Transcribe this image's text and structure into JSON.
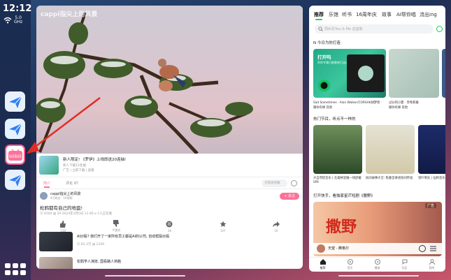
{
  "status": {
    "time": "12:12",
    "wifi_band": "5.0",
    "wifi_unit": "GHz"
  },
  "dock": {
    "apps": [
      {
        "name": "Feishu"
      },
      {
        "name": "Feishu (2)"
      },
      {
        "name": "bilibili",
        "badge": "bilibili"
      },
      {
        "name": "Feishu Docs"
      }
    ]
  },
  "bili": {
    "watermark": "cappi指尖上的风景",
    "watermark_logo": "bilibili",
    "notice": {
      "title": "新人限定! 《罗伊》上线即送20连抽!",
      "sub": "新人下载12连抽",
      "sub2": "广告 | 立即下载 | 查看"
    },
    "tabs": {
      "intro": "简介",
      "comments": "评论 97"
    },
    "danmu_placeholder": "点我发弹幕",
    "uploader": {
      "name": "cappi指尖上的风景",
      "fans": "4万粉丝 · 16视频"
    },
    "follow_label": "+ 关注",
    "video_title": "松鸦都有自己的地盘!",
    "video_meta": "⓵ 4504  ▤ 20  2024年1月5日 11:46  ⌀ 1人正在看",
    "actions": [
      {
        "label": "138"
      },
      {
        "label": "不喜欢"
      },
      {
        "label": "36"
      },
      {
        "label": "107"
      },
      {
        "label": "16"
      }
    ],
    "recs": [
      {
        "title": "AI炒股? 我们开了一家所有员工都是AI的公司, 自动帮股炒股",
        "meta": "⓵ 81.2万  ▤ 1249"
      },
      {
        "title": "松鸦学人演技, 国看路人熟胞",
        "meta": ""
      }
    ]
  },
  "music": {
    "tabs": [
      "推荐",
      "乐馆",
      "听书",
      "16周年庆",
      "故事",
      "AI帮你唱",
      "流出ing"
    ],
    "search_placeholder": "周AI写You & Me 这首歌",
    "section1": "N 今日为你打造",
    "card1": {
      "title": "打开吗",
      "sub": "你的专属日推歌单已送达\n根据每日推荐生成"
    },
    "card1_caption": "Sad Sometimes · Alan Walker/CORSAK胡梦周 ·",
    "card1_caption2": "跟你有缘 其他",
    "card2_caption": "过分的小夏 · 李希莉雅",
    "card2_caption2": "跟你有缘 其他",
    "section2": "热门节目，听点不一样的",
    "hot": [
      {
        "caption": "大自然轻音乐 | 在森林里做一场舒缓SPA"
      },
      {
        "caption": "民间故事大全: 陈嘉音讲述民间传说"
      },
      {
        "caption": "曳叶明天 | 仙师音乐"
      }
    ],
    "section3": "打开快手，看独家星芒短剧《撒野》",
    "banner": {
      "title": "撒野",
      "ad": "广告"
    },
    "player": {
      "title": "天望 - 腾格尔"
    },
    "nav": [
      {
        "label": "推荐"
      },
      {
        "label": "音乐"
      },
      {
        "label": "播放"
      },
      {
        "label": "社区"
      },
      {
        "label": "我的"
      }
    ],
    "accent": "#1ec760"
  },
  "colors": {
    "bili_pink": "#fb7299",
    "music_green": "#1ec760"
  }
}
